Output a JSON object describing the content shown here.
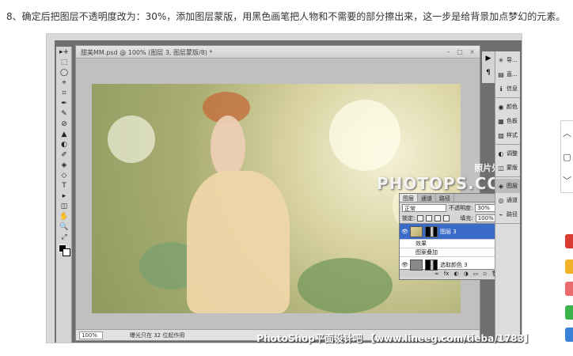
{
  "article": {
    "step_text": "8、确定后把图层不透明度改为：30%，添加图层蒙版，用黑色画笔把人物和不需要的部分擦出来，这一步是给背景加点梦幻的元素。"
  },
  "photoshop": {
    "doc_title": "甜美MM.psd @ 100% (图层 3, 图层蒙版/8) *",
    "zoom": "100%",
    "doc_status": "曝光只在 32 位起作用",
    "watermark_sub": "照片处理网",
    "watermark_main": "PHOTOPS.COM",
    "tools": [
      "▸+",
      "⬚",
      "◯",
      "⌖",
      "⌗",
      "✒",
      "✎",
      "⊘",
      "▲",
      "◐",
      "✐",
      "◈",
      "◇",
      "T",
      "▸",
      "◫",
      "✋",
      "🔍",
      "⤢"
    ],
    "dock_icons": [
      "▶",
      "¶"
    ],
    "panels": [
      {
        "icon": "✳",
        "label": "导..."
      },
      {
        "icon": "▤",
        "label": "直..."
      },
      {
        "icon": "ℹ",
        "label": "信息"
      },
      {
        "icon": "◉",
        "label": "颜色"
      },
      {
        "icon": "▦",
        "label": "色板"
      },
      {
        "icon": "▧",
        "label": "样式"
      },
      {
        "icon": "◐",
        "label": "调整"
      },
      {
        "icon": "◫",
        "label": "蒙版"
      },
      {
        "icon": "◈",
        "label": "图层"
      },
      {
        "icon": "◎",
        "label": "通道"
      },
      {
        "icon": "⌁",
        "label": "路径"
      }
    ],
    "active_panel": "图层",
    "layers_panel": {
      "tabs": [
        "图层",
        "通道",
        "路径"
      ],
      "blend_mode": "正常",
      "opacity_label": "不透明度:",
      "opacity": "30%",
      "lock_label": "锁定:",
      "fill_label": "填充:",
      "fill": "100%",
      "layers": [
        {
          "name": "图层 3",
          "selected": true
        },
        {
          "name": "效果",
          "sub": true
        },
        {
          "name": "图案叠加",
          "sub": true
        },
        {
          "name": "选取颜色 3",
          "selected": false
        }
      ],
      "bottom_icons": [
        "∞",
        "fx",
        "◐",
        "◑",
        "▭",
        "▫",
        "🗑"
      ]
    }
  },
  "footer_watermark": "PhotoShop平面设计吧 【www.lineeg.com/tieba/1783】",
  "colors": {
    "ps_background": "#6f6f6f",
    "selected_layer": "#3a6bc9"
  }
}
